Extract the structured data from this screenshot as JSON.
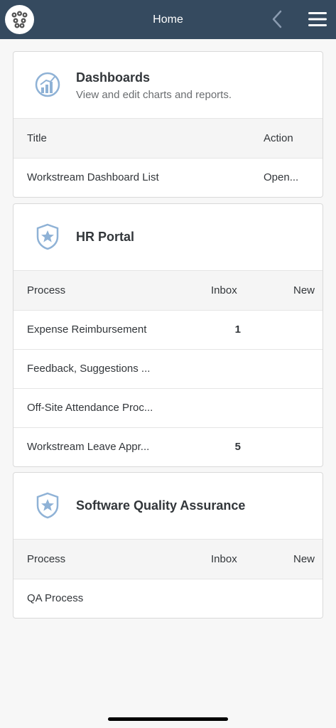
{
  "topbar": {
    "title": "Home"
  },
  "dashboards": {
    "title": "Dashboards",
    "subtitle": "View and edit charts and reports.",
    "columns": {
      "title": "Title",
      "action": "Action"
    },
    "rows": [
      {
        "title": "Workstream Dashboard List",
        "action": "Open..."
      }
    ]
  },
  "hr_portal": {
    "title": "HR Portal",
    "columns": {
      "process": "Process",
      "inbox": "Inbox",
      "new": "New"
    },
    "rows": [
      {
        "process": "Expense Reimbursement",
        "inbox": "1"
      },
      {
        "process": "Feedback, Suggestions ...",
        "inbox": ""
      },
      {
        "process": "Off-Site Attendance Proc...",
        "inbox": ""
      },
      {
        "process": "Workstream Leave Appr...",
        "inbox": "5"
      }
    ]
  },
  "sqa": {
    "title": "Software Quality Assurance",
    "columns": {
      "process": "Process",
      "inbox": "Inbox",
      "new": "New"
    },
    "rows": [
      {
        "process": "QA Process",
        "inbox": ""
      }
    ]
  },
  "colors": {
    "header_bg": "#354a5f",
    "icon_blue": "#8fb2d6"
  }
}
